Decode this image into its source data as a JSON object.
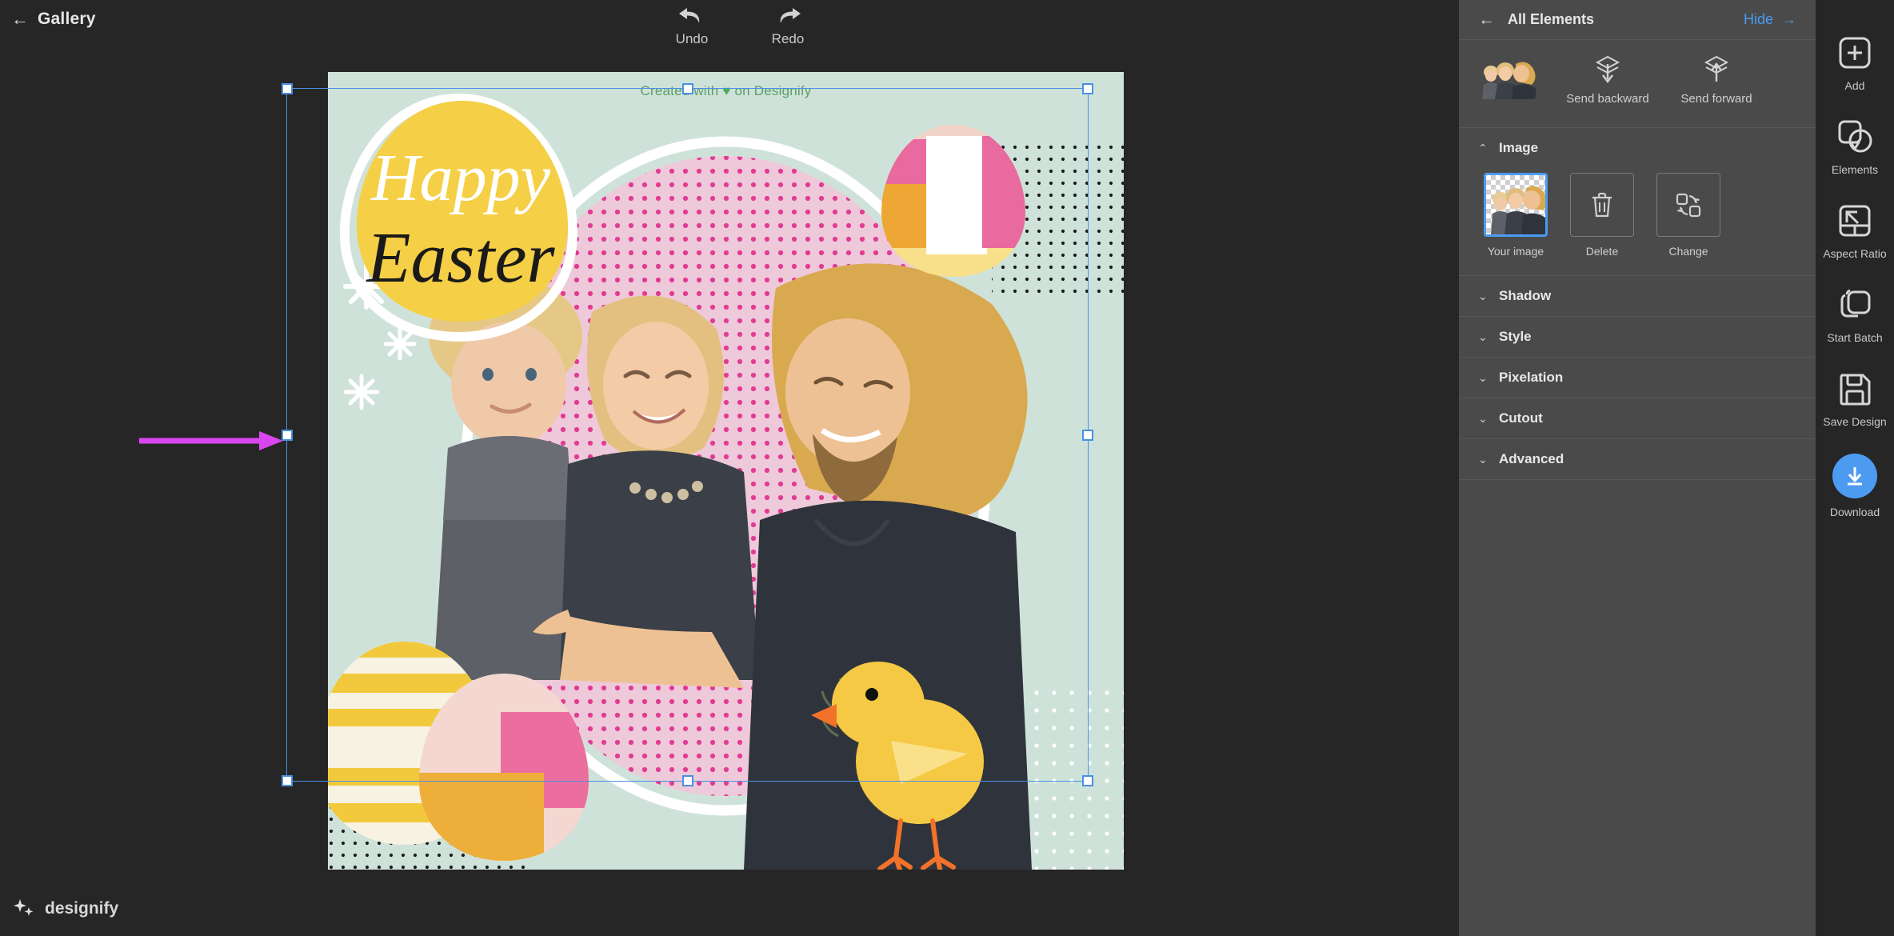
{
  "app": {
    "brand_name": "designify",
    "brand_icon": "sparkles-icon"
  },
  "topbar": {
    "back_arrow": "←",
    "gallery_label": "Gallery",
    "undo_label": "Undo",
    "redo_label": "Redo"
  },
  "canvas": {
    "watermark_prefix": "Created with",
    "watermark_heart": "♥",
    "watermark_suffix": "on Designify",
    "headline_top": "Happy",
    "headline_bottom": "Easter",
    "selection_color": "#4a90e2",
    "annotation_arrow_color": "#d946ef",
    "background_mint": "#cfe2da",
    "egg_yellow": "#f5cf45",
    "oval_pink": "#efc6d8",
    "dot_pink": "#e0338f",
    "chick_yellow": "#f6c944",
    "chick_beak": "#f2722a"
  },
  "panel": {
    "back_arrow": "←",
    "title": "All Elements",
    "hide_label": "Hide",
    "hide_arrow": "→",
    "layer": {
      "thumbnail_name": "selected-layer-thumbnail",
      "send_backward_label": "Send backward",
      "send_forward_label": "Send forward"
    },
    "sections": [
      {
        "name": "image",
        "label": "Image",
        "expanded": true,
        "chevron": "⌃",
        "tiles": [
          {
            "name": "your-image",
            "label": "Your image",
            "icon": "photo-thumbnail",
            "selected": true
          },
          {
            "name": "delete",
            "label": "Delete",
            "icon": "trash-icon",
            "selected": false
          },
          {
            "name": "change",
            "label": "Change",
            "icon": "swap-shapes-icon",
            "selected": false
          }
        ]
      },
      {
        "name": "shadow",
        "label": "Shadow",
        "expanded": false,
        "chevron": "⌄"
      },
      {
        "name": "style",
        "label": "Style",
        "expanded": false,
        "chevron": "⌄"
      },
      {
        "name": "pixelation",
        "label": "Pixelation",
        "expanded": false,
        "chevron": "⌄"
      },
      {
        "name": "cutout",
        "label": "Cutout",
        "expanded": false,
        "chevron": "⌄"
      },
      {
        "name": "advanced",
        "label": "Advanced",
        "expanded": false,
        "chevron": "⌄"
      }
    ]
  },
  "rail": {
    "items": [
      {
        "name": "add",
        "label": "Add",
        "icon": "plus-square-icon"
      },
      {
        "name": "elements",
        "label": "Elements",
        "icon": "shapes-icon"
      },
      {
        "name": "aspect-ratio",
        "label": "Aspect Ratio",
        "icon": "aspect-ratio-icon"
      },
      {
        "name": "start-batch",
        "label": "Start Batch",
        "icon": "layers-stack-icon"
      },
      {
        "name": "save-design",
        "label": "Save Design",
        "icon": "floppy-disk-icon"
      },
      {
        "name": "download",
        "label": "Download",
        "icon": "download-arrow-icon",
        "accent": "#4d9bf0"
      }
    ]
  }
}
